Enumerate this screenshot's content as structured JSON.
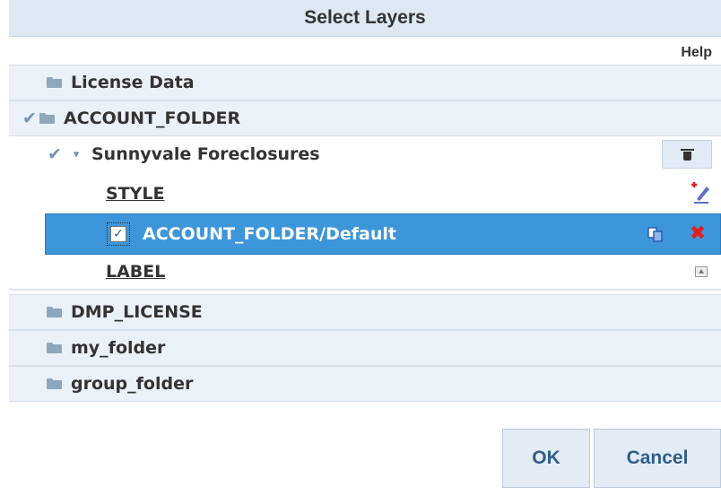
{
  "dialog": {
    "title": "Select Layers",
    "help": "Help"
  },
  "layers": [
    {
      "name": "License Data"
    },
    {
      "name": "ACCOUNT_FOLDER",
      "checked": true
    },
    {
      "name": "DMP_LICENSE"
    },
    {
      "name": "my_folder"
    },
    {
      "name": "group_folder"
    }
  ],
  "layer_item": {
    "name": "Sunnyvale Foreclosures",
    "checked": true,
    "expanded": true
  },
  "style": {
    "heading": "STYLE",
    "selected_style": "ACCOUNT_FOLDER/Default",
    "selected_checked": true
  },
  "label": {
    "heading": "LABEL"
  },
  "buttons": {
    "ok": "OK",
    "cancel": "Cancel"
  },
  "icons": {
    "check": "✔",
    "expand": "▾",
    "checkbox_mark": "✓",
    "delete_x": "✖",
    "trash": "trash-icon",
    "edit_style": "edit-style-icon",
    "copy": "copy-icon",
    "label_image": "label-image-icon",
    "folder": "folder-icon"
  },
  "colors": {
    "title_bg": "#dde8f3",
    "folder_row_bg": "#ebf1f8",
    "selected_bg": "#3d96d9",
    "check_color": "#6f93b8",
    "delete_color": "#e21f1f",
    "button_text": "#2f5e8a"
  }
}
